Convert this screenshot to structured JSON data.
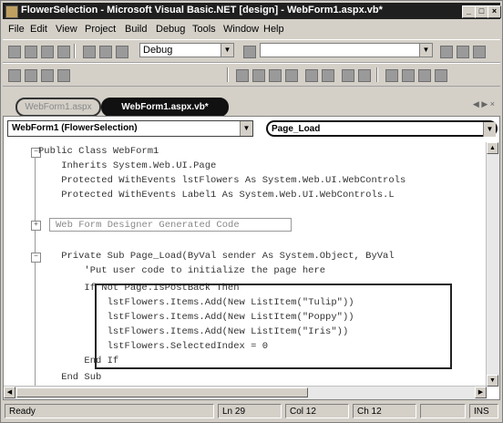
{
  "window": {
    "title": "FlowerSelection - Microsoft Visual Basic.NET [design] - WebForm1.aspx.vb*"
  },
  "menu": [
    "File",
    "Edit",
    "View",
    "Project",
    "Build",
    "Debug",
    "Tools",
    "Window",
    "Help"
  ],
  "toolbar": {
    "config_select": "Debug"
  },
  "tabs": {
    "inactive": "WebForm1.aspx",
    "active": "WebForm1.aspx.vb*"
  },
  "code_window": {
    "class_combo": "WebForm1 (FlowerSelection)",
    "method_combo": "Page_Load",
    "lines": [
      "Public Class WebForm1",
      "    Inherits System.Web.UI.Page",
      "    Protected WithEvents lstFlowers As System.Web.UI.WebControls",
      "    Protected WithEvents Label1 As System.Web.UI.WebControls.L",
      "Web Form Designer Generated Code",
      "    Private Sub Page_Load(ByVal sender As System.Object, ByVal",
      "        'Put user code to initialize the page here",
      "        If Not Page.IsPostBack Then",
      "            lstFlowers.Items.Add(New ListItem(\"Tulip\"))",
      "            lstFlowers.Items.Add(New ListItem(\"Poppy\"))",
      "            lstFlowers.Items.Add(New ListItem(\"Iris\"))",
      "            lstFlowers.SelectedIndex = 0",
      "        End If",
      "    End Sub"
    ]
  },
  "status": {
    "ready": "Ready",
    "line": "Ln 29",
    "col": "Col 12",
    "ch": "Ch 12",
    "mode": "INS"
  }
}
